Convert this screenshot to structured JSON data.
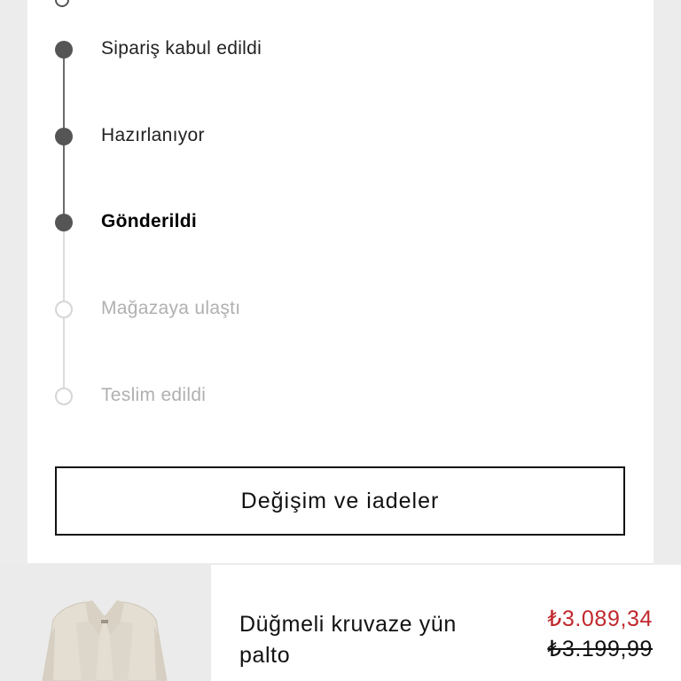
{
  "order_tracking": {
    "steps": [
      {
        "label": "Sipariş kabul edildi",
        "state": "done"
      },
      {
        "label": "Hazırlanıyor",
        "state": "done"
      },
      {
        "label": "Gönderildi",
        "state": "current"
      },
      {
        "label": "Mağazaya ulaştı",
        "state": "pending"
      },
      {
        "label": "Teslim edildi",
        "state": "pending"
      }
    ],
    "exchange_button_label": "Değişim ve iadeler"
  },
  "product": {
    "name": "Düğmeli kruvaze yün palto",
    "price_current": "₺3.089,34",
    "price_original": "₺3.199,99",
    "currency_color": "#c0282d"
  },
  "colors": {
    "done_marker": "#555555",
    "pending_marker": "#d6d6d6",
    "background": "#ececec"
  }
}
